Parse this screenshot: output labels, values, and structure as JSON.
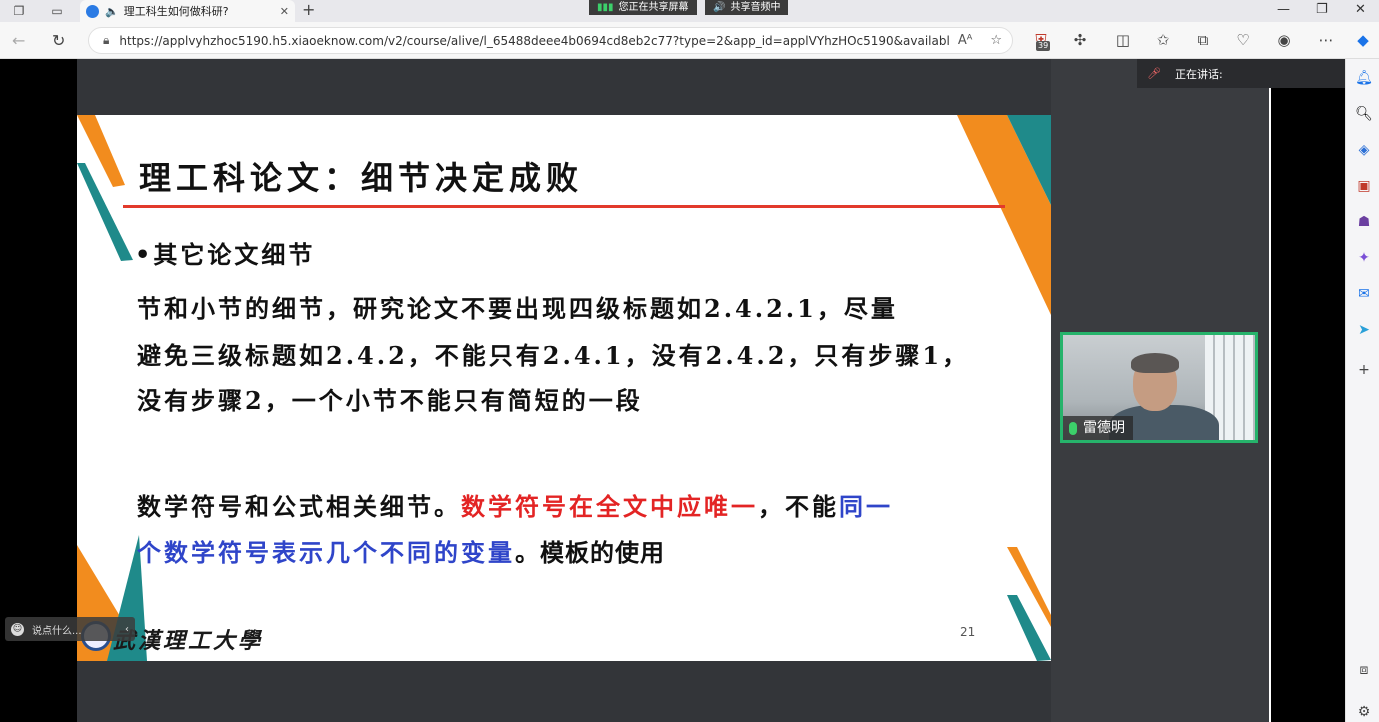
{
  "browser": {
    "tab": {
      "title": "理工科生如何做科研?",
      "close": "✕"
    },
    "new_tab": "+",
    "share_screen": "您正在共享屏幕",
    "share_audio": "共享音频中",
    "window_controls": {
      "minimize": "—",
      "restore": "❐",
      "close": "✕"
    },
    "url": "https://applvyhzhoc5190.h5.xiaoeknow.com/v2/course/alive/l_65488deee4b0694cd8eb2c77?type=2&app_id=applVYhzHOc5190&available=tr...",
    "read_aloud": "Aᴬ",
    "extension_badge": "39"
  },
  "slide": {
    "title": "理工科论文：细节决定成败",
    "bullet": "•其它论文细节",
    "para1": [
      "节和小节的细节，研究论文不要出现四级标题如2.4.2.1，尽量",
      "避免三级标题如2.4.2，不能只有2.4.1，没有2.4.2，只有步骤1，",
      "没有步骤2，一个小节不能只有简短的一段"
    ],
    "para2": {
      "line1_black": "数学符号和公式相关细节。",
      "line1_red": "数学符号在全文中应唯一",
      "line1_black2": "，不能",
      "line1_blue": "同一",
      "line2_blue": "个数学符号表示几个不同的变量",
      "line2_black": "。模板的使用"
    },
    "page_number": "21",
    "school_name": "武漢理工大學"
  },
  "webcam": {
    "name": "雷德明"
  },
  "speaking": {
    "label": "正在讲话:"
  },
  "chat": {
    "placeholder": "说点什么...",
    "collapse": "‹"
  },
  "colors": {
    "accent_green": "#26b36b",
    "red_text": "#e32424",
    "blue_text": "#2f45c9",
    "title_rule": "#e23a2b",
    "orange": "#f28c1e",
    "teal": "#1f8a8a"
  }
}
